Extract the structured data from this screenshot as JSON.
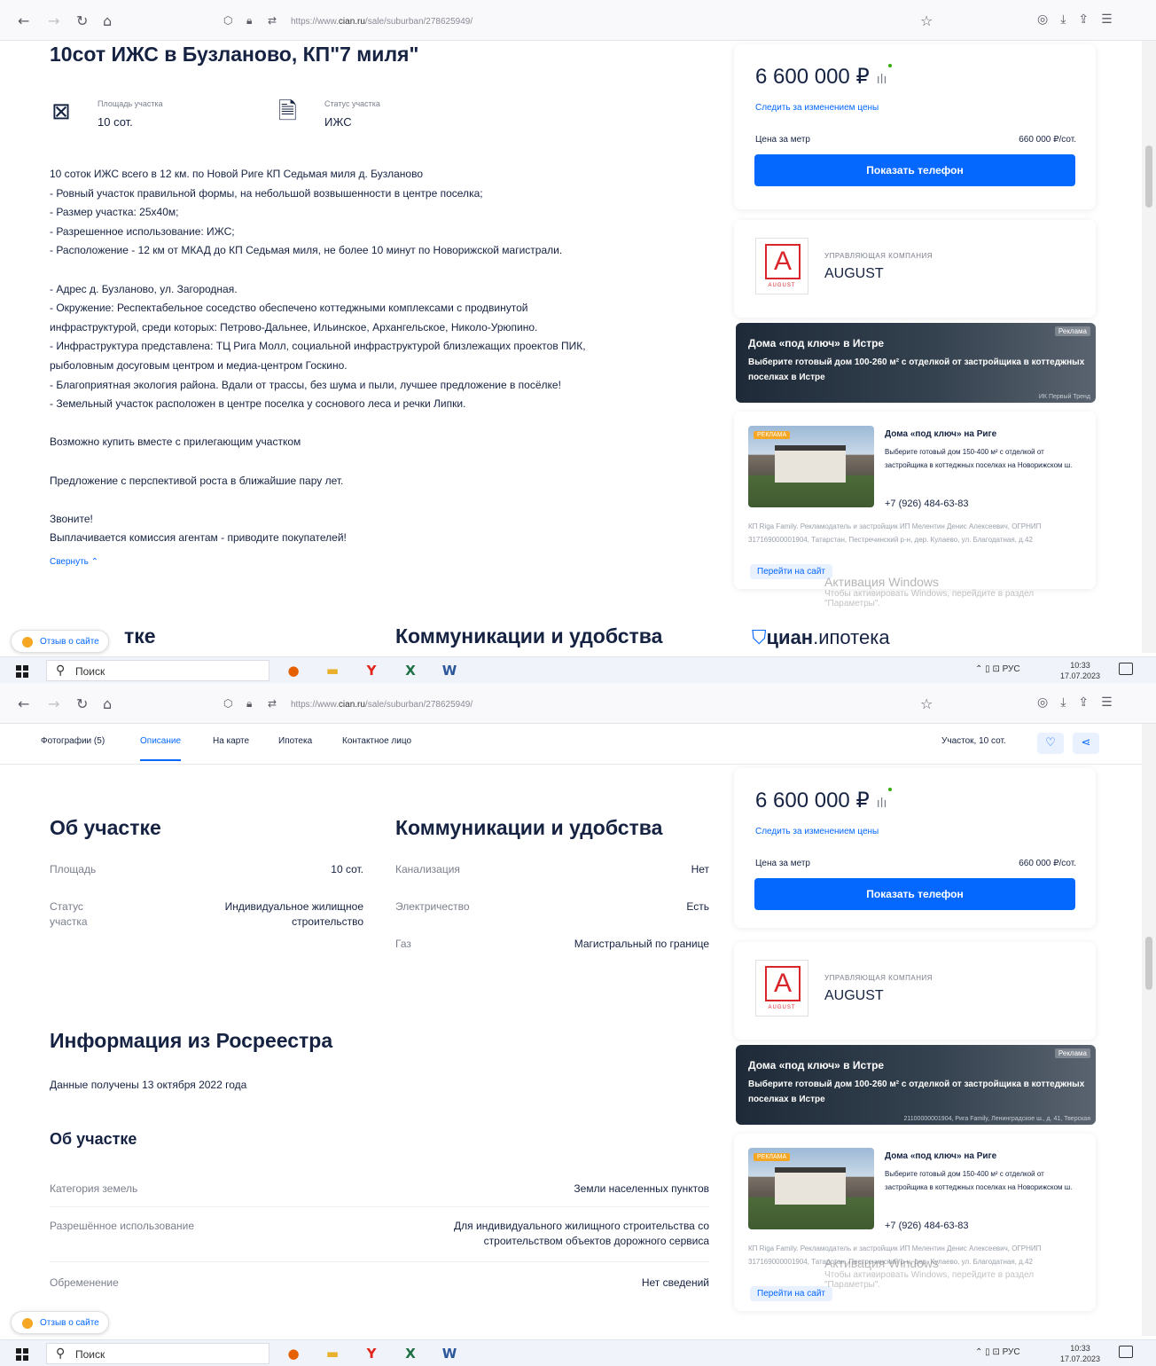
{
  "browser": {
    "url_prefix": "https://www.",
    "url_domain": "cian.ru",
    "url_path": "/sale/suburban/278625949/"
  },
  "listing": {
    "title": "10сот ИЖС в Бузланово, КП\"7 миля\"",
    "features": [
      {
        "icon": "area-icon",
        "label": "Площадь участка",
        "value": "10 сот."
      },
      {
        "icon": "document-status-icon",
        "label": "Статус участка",
        "value": "ИЖС"
      }
    ],
    "description": [
      "10 соток ИЖС всего в 12 км. по Новой Риге КП Седьмая миля  д. Бузланово",
      "- Ровный участок правильной формы, на небольшой возвышенности в центре поселка;",
      "- Размер участка: 25х40м;",
      "- Разрешенное использование: ИЖС;",
      "- Расположение - 12 км от МКАД до КП Седьмая миля, не более 10 минут по Новорижской магистрали.",
      "",
      "- Адрес д. Бузланово, ул. Загородная.",
      "- Окружение: Респектабельное соседство обеспечено коттеджными комплексами с продвинутой",
      "инфраструктурой, среди которых: Петрово-Дальнее, Ильинское, Архангельское, Николо-Урюпино.",
      "-  Инфраструктура представлена: ТЦ Рига Молл, социальной инфраструктурой близлежащих проектов ПИК,",
      "рыболовным досуговым центром и медиа-центром Госкино.",
      "- Благоприятная экология района. Вдали от трассы, без шума и пыли, лучшее предложение в посёлке!",
      "- Земельный участок расположен в центре поселка у соснового леса и речки Липки.",
      "",
      "Возможно купить вместе с прилегающим участком",
      "",
      "Предложение с перспективой роста в ближайшие пару лет.",
      "",
      "Звоните!",
      "Выплачивается комиссия агентам - приводите покупателей!"
    ],
    "collapse_label": "Свернуть",
    "section_about_partial": "тке",
    "section_about": "Об участке",
    "section_comms": "Коммуникации и удобства"
  },
  "price_card": {
    "price": "6 600 000 ₽",
    "follow_label": "Следить за изменением цены",
    "per_unit_label": "Цена за метр",
    "per_unit_value": "660 000 ₽/сот.",
    "show_phone": "Показать телефон"
  },
  "agent": {
    "label": "УПРАВЛЯЮЩАЯ КОМПАНИЯ",
    "name": "AUGUST",
    "logo_letter": "A",
    "logo_sub": "AUGUST"
  },
  "ad_banner": {
    "tag": "Реклама",
    "title": "Дома «под ключ» в Истре",
    "text": "Выберите готовый дом 100-260 м² с отделкой от застройщика в коттеджных поселках в Истре",
    "fine_1": "ИК Первый Тренд",
    "fine_2": "21100000001904, Рига Family, Ленинградское ш., д. 41, Тверская"
  },
  "ad_card": {
    "badge": "РЕКЛАМА",
    "title": "Дома «под ключ» на Риге",
    "text": "Выберите готовый дом 150-400 м² с отделкой от застройщика в коттеджных поселках на Новорижском ш.",
    "phone": "+7 (926) 484-63-83",
    "fine": "КП Riga Family. Рекламодатель и застройщик ИП Мелентин Денис Алексеевич, ОГРНИП 317169000001904, Татарстан, Пестречинский р-н, дер. Кулаево, ул. Благодатная, д.42",
    "go": "Перейти на сайт"
  },
  "windows_activation": {
    "title": "Активация Windows",
    "line1": "Чтобы активировать Windows, перейдите в раздел",
    "line2": "\"Параметры\"."
  },
  "cian_logo": {
    "bold": "циан",
    "rest": ".ипотека"
  },
  "feedback": "Отзыв о сайте",
  "taskbar": {
    "search": "Поиск",
    "lang": "РУС",
    "time": "10:33",
    "date": "17.07.2023",
    "apps": [
      {
        "icon": "firefox-icon",
        "glyph": "●",
        "color": "#e66000"
      },
      {
        "icon": "file-explorer-icon",
        "glyph": "▬",
        "color": "#e8b02b"
      },
      {
        "icon": "yandex-browser-icon",
        "glyph": "Y",
        "color": "#e1251b"
      },
      {
        "icon": "excel-icon",
        "glyph": "X",
        "color": "#1d7044"
      },
      {
        "icon": "word-icon",
        "glyph": "W",
        "color": "#2b579a"
      }
    ]
  },
  "tabs": [
    "Фотографии (5)",
    "Описание",
    "На карте",
    "Ипотека",
    "Контактное лицо"
  ],
  "tabs_right_label": "Участок, 10 сот.",
  "about": [
    {
      "k": "Площадь",
      "v": "10 сот."
    },
    {
      "k": "Статус участка",
      "v": "Индивидуальное жилищное строительство"
    }
  ],
  "comms": [
    {
      "k": "Канализация",
      "v": "Нет"
    },
    {
      "k": "Электричество",
      "v": "Есть"
    },
    {
      "k": "Газ",
      "v": "Магистральный по границе"
    }
  ],
  "rosreestr": {
    "title": "Информация из Росреестра",
    "date_note": "Данные получены 13 октября 2022 года",
    "sub_title": "Об участке",
    "rows": [
      {
        "k": "Категория земель",
        "v": "Земли населенных пунктов"
      },
      {
        "k": "Разрешённое использование",
        "v": "Для индивидуального жилищного строительства со строительством объектов дорожного сервиса"
      },
      {
        "k": "Обременение",
        "v": "Нет сведений"
      }
    ]
  },
  "colors": {
    "accent": "#0468ff",
    "text": "#152242",
    "muted": "#7a7f8c",
    "brand_red": "#d9262b"
  }
}
